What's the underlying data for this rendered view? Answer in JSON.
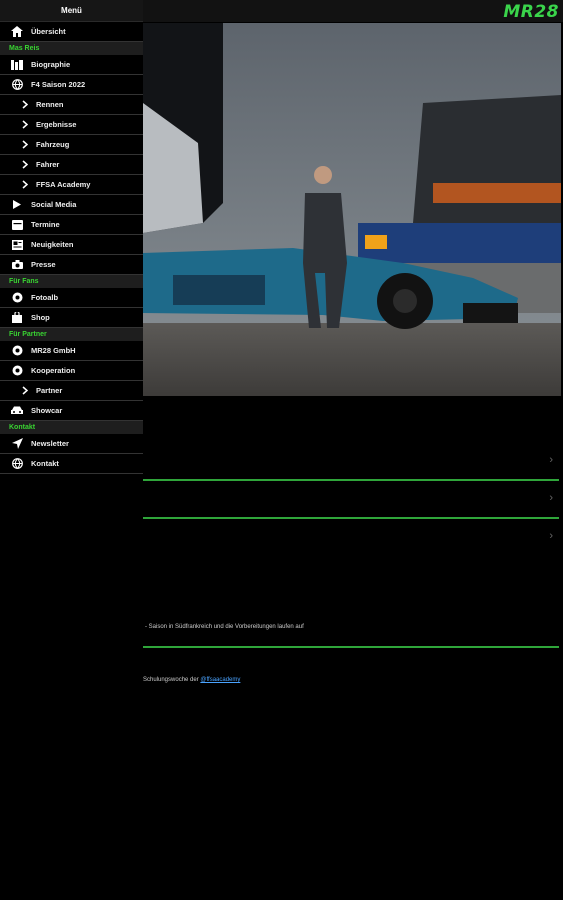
{
  "menu": {
    "title": "Menü",
    "items": [
      {
        "type": "item",
        "label": "Übersicht",
        "icon": "home-icon"
      },
      {
        "type": "section",
        "label": "Mas Reis"
      },
      {
        "type": "item",
        "label": "Biographie",
        "icon": "book-icon"
      },
      {
        "type": "item",
        "label": "F4 Saison 2022",
        "icon": "globe-icon"
      },
      {
        "type": "sub",
        "label": "Rennen",
        "icon": "chevron-right-icon"
      },
      {
        "type": "sub",
        "label": "Ergebnisse",
        "icon": "chevron-right-icon"
      },
      {
        "type": "sub",
        "label": "Fahrzeug",
        "icon": "chevron-right-icon"
      },
      {
        "type": "sub",
        "label": "Fahrer",
        "icon": "chevron-right-icon"
      },
      {
        "type": "sub",
        "label": "FFSA Academy",
        "icon": "chevron-right-icon"
      },
      {
        "type": "item",
        "label": "Social Media",
        "icon": "play-icon"
      },
      {
        "type": "item",
        "label": "Termine",
        "icon": "calendar-icon"
      },
      {
        "type": "item",
        "label": "Neuigkeiten",
        "icon": "news-icon"
      },
      {
        "type": "item",
        "label": "Presse",
        "icon": "camera-icon"
      },
      {
        "type": "section",
        "label": "Für Fans"
      },
      {
        "type": "item",
        "label": "Fotoalb",
        "icon": "photo-icon"
      },
      {
        "type": "item",
        "label": "Shop",
        "icon": "bag-icon"
      },
      {
        "type": "section",
        "label": "Für Partner"
      },
      {
        "type": "item",
        "label": "MR28 GmbH",
        "icon": "circle-icon"
      },
      {
        "type": "item",
        "label": "Kooperation",
        "icon": "circle-icon"
      },
      {
        "type": "sub",
        "label": "Partner",
        "icon": "chevron-right-icon"
      },
      {
        "type": "item",
        "label": "Showcar",
        "icon": "car-icon"
      },
      {
        "type": "section",
        "label": "Kontakt"
      },
      {
        "type": "item",
        "label": "Newsletter",
        "icon": "send-icon"
      },
      {
        "type": "item",
        "label": "Kontakt",
        "icon": "globe-icon"
      }
    ]
  },
  "header": {
    "logo": "MR28"
  },
  "content": {
    "text1": "- Saison in Südfrankreich und die Vorbereitungen laufen auf",
    "text2_prefix": "Schulungswoche der ",
    "text2_link": "@ffsaacademy"
  },
  "colors": {
    "accent": "#3ad44b",
    "background": "#000000"
  }
}
